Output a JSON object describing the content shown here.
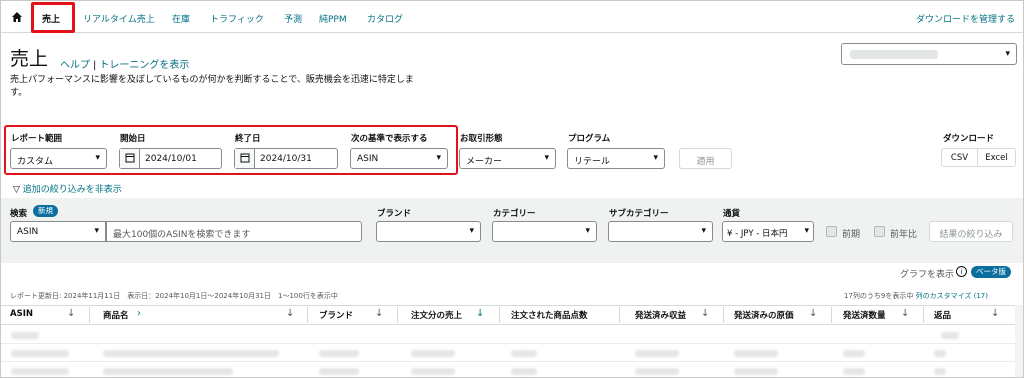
{
  "nav": {
    "items": [
      "売上",
      "リアルタイム売上",
      "在庫",
      "トラフィック",
      "予測",
      "純PPM",
      "カタログ"
    ],
    "manage_downloads": "ダウンロードを管理する"
  },
  "header": {
    "title": "売上",
    "help": "ヘルプ",
    "training": "トレーニングを表示",
    "description": "売上パフォーマンスに影響を及ぼしているものが何かを判断することで、販売機会を迅速に特定します。"
  },
  "filters": {
    "report_range_label": "レポート範囲",
    "report_range_value": "カスタム",
    "start_label": "開始日",
    "start_value": "2024/10/01",
    "end_label": "終了日",
    "end_value": "2024/10/31",
    "show_by_label": "次の基準で表示する",
    "show_by_value": "ASIN",
    "distributor_label": "お取引形態",
    "distributor_value": "メーカー",
    "program_label": "プログラム",
    "program_value": "リテール",
    "apply": "適用",
    "download_label": "ダウンロード",
    "csv": "CSV",
    "excel": "Excel",
    "hide_filters": "追加の絞り込みを非表示"
  },
  "search": {
    "label": "検索",
    "new_badge": "新規",
    "type_value": "ASIN",
    "placeholder": "最大100個のASINを検索できます",
    "brand_label": "ブランド",
    "category_label": "カテゴリー",
    "subcategory_label": "サブカテゴリー",
    "currency_label": "通貨",
    "currency_value": "¥ - JPY - 日本円",
    "prev_period": "前期",
    "prev_year": "前年比",
    "refine": "結果の絞り込み"
  },
  "graph": {
    "show_graph": "グラフを表示",
    "beta": "ベータ版"
  },
  "meta": {
    "report_info": "レポート更新日: 2024年11月11日　表示日：2024年10月1日～2024年10月31日　1～100行を表示中",
    "cols_shown": "17列のうち9を表示中",
    "customize_cols": "列のカスタマイズ (17)"
  },
  "table": {
    "headers": [
      "ASIN",
      "商品名",
      "ブランド",
      "注文分の売上",
      "注文された商品点数",
      "発送済み収益",
      "発送済みの原価",
      "発送済数量",
      "返品"
    ]
  }
}
